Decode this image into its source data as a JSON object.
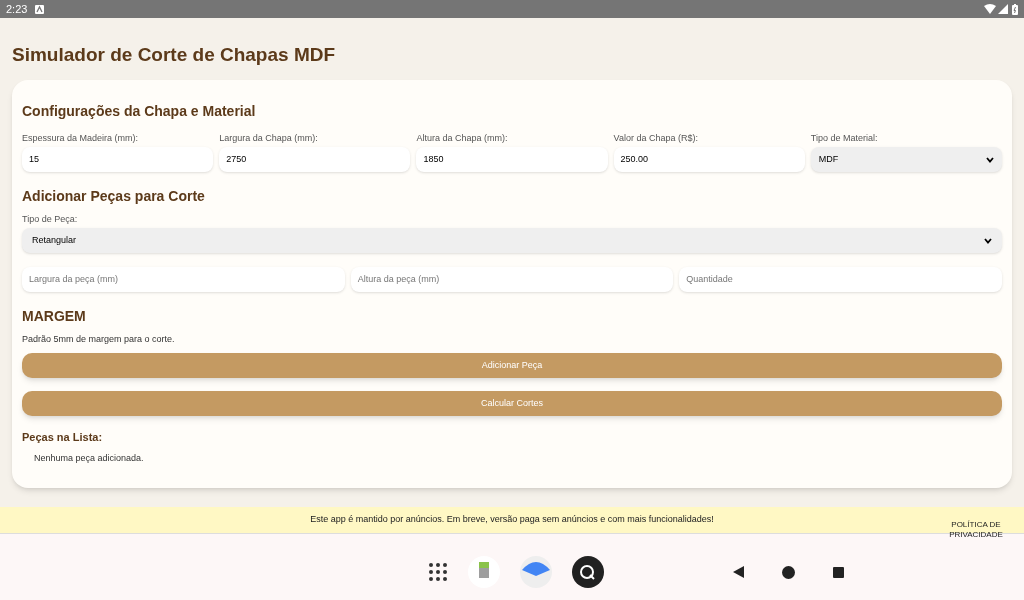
{
  "status_bar": {
    "time": "2:23"
  },
  "title": "Simulador de Corte de Chapas MDF",
  "sheet_section": {
    "heading": "Configurações da Chapa e Material",
    "fields": [
      {
        "kind": "input",
        "label": "Espessura da Madeira (mm):",
        "value": "15"
      },
      {
        "kind": "input",
        "label": "Largura da Chapa (mm):",
        "value": "2750"
      },
      {
        "kind": "input",
        "label": "Altura da Chapa (mm):",
        "value": "1850"
      },
      {
        "kind": "input",
        "label": "Valor da Chapa (R$):",
        "value": "250.00"
      },
      {
        "kind": "select",
        "label": "Tipo de Material:",
        "value": "MDF"
      }
    ]
  },
  "pieces_section": {
    "heading": "Adicionar Peças para Corte",
    "piece_type": {
      "label": "Tipo de Peça:",
      "value": "Retangular"
    },
    "inputs": [
      {
        "placeholder": "Largura da peça (mm)"
      },
      {
        "placeholder": "Altura da peça (mm)"
      },
      {
        "placeholder": "Quantidade"
      }
    ]
  },
  "margin_section": {
    "heading": "MARGEM",
    "text": "Padrão 5mm de margem para o corte."
  },
  "buttons": [
    "Adicionar Peça",
    "Calcular Cortes"
  ],
  "list_section": {
    "heading": "Peças na Lista:",
    "empty_text": "Nenhuma peça adicionada."
  },
  "ad_banner": {
    "text": "Este app é mantido por anúncios. Em breve, versão paga sem anúncios e com mais funcionalidades!",
    "link": "POLÍTICA DE PRIVACIDADE"
  }
}
